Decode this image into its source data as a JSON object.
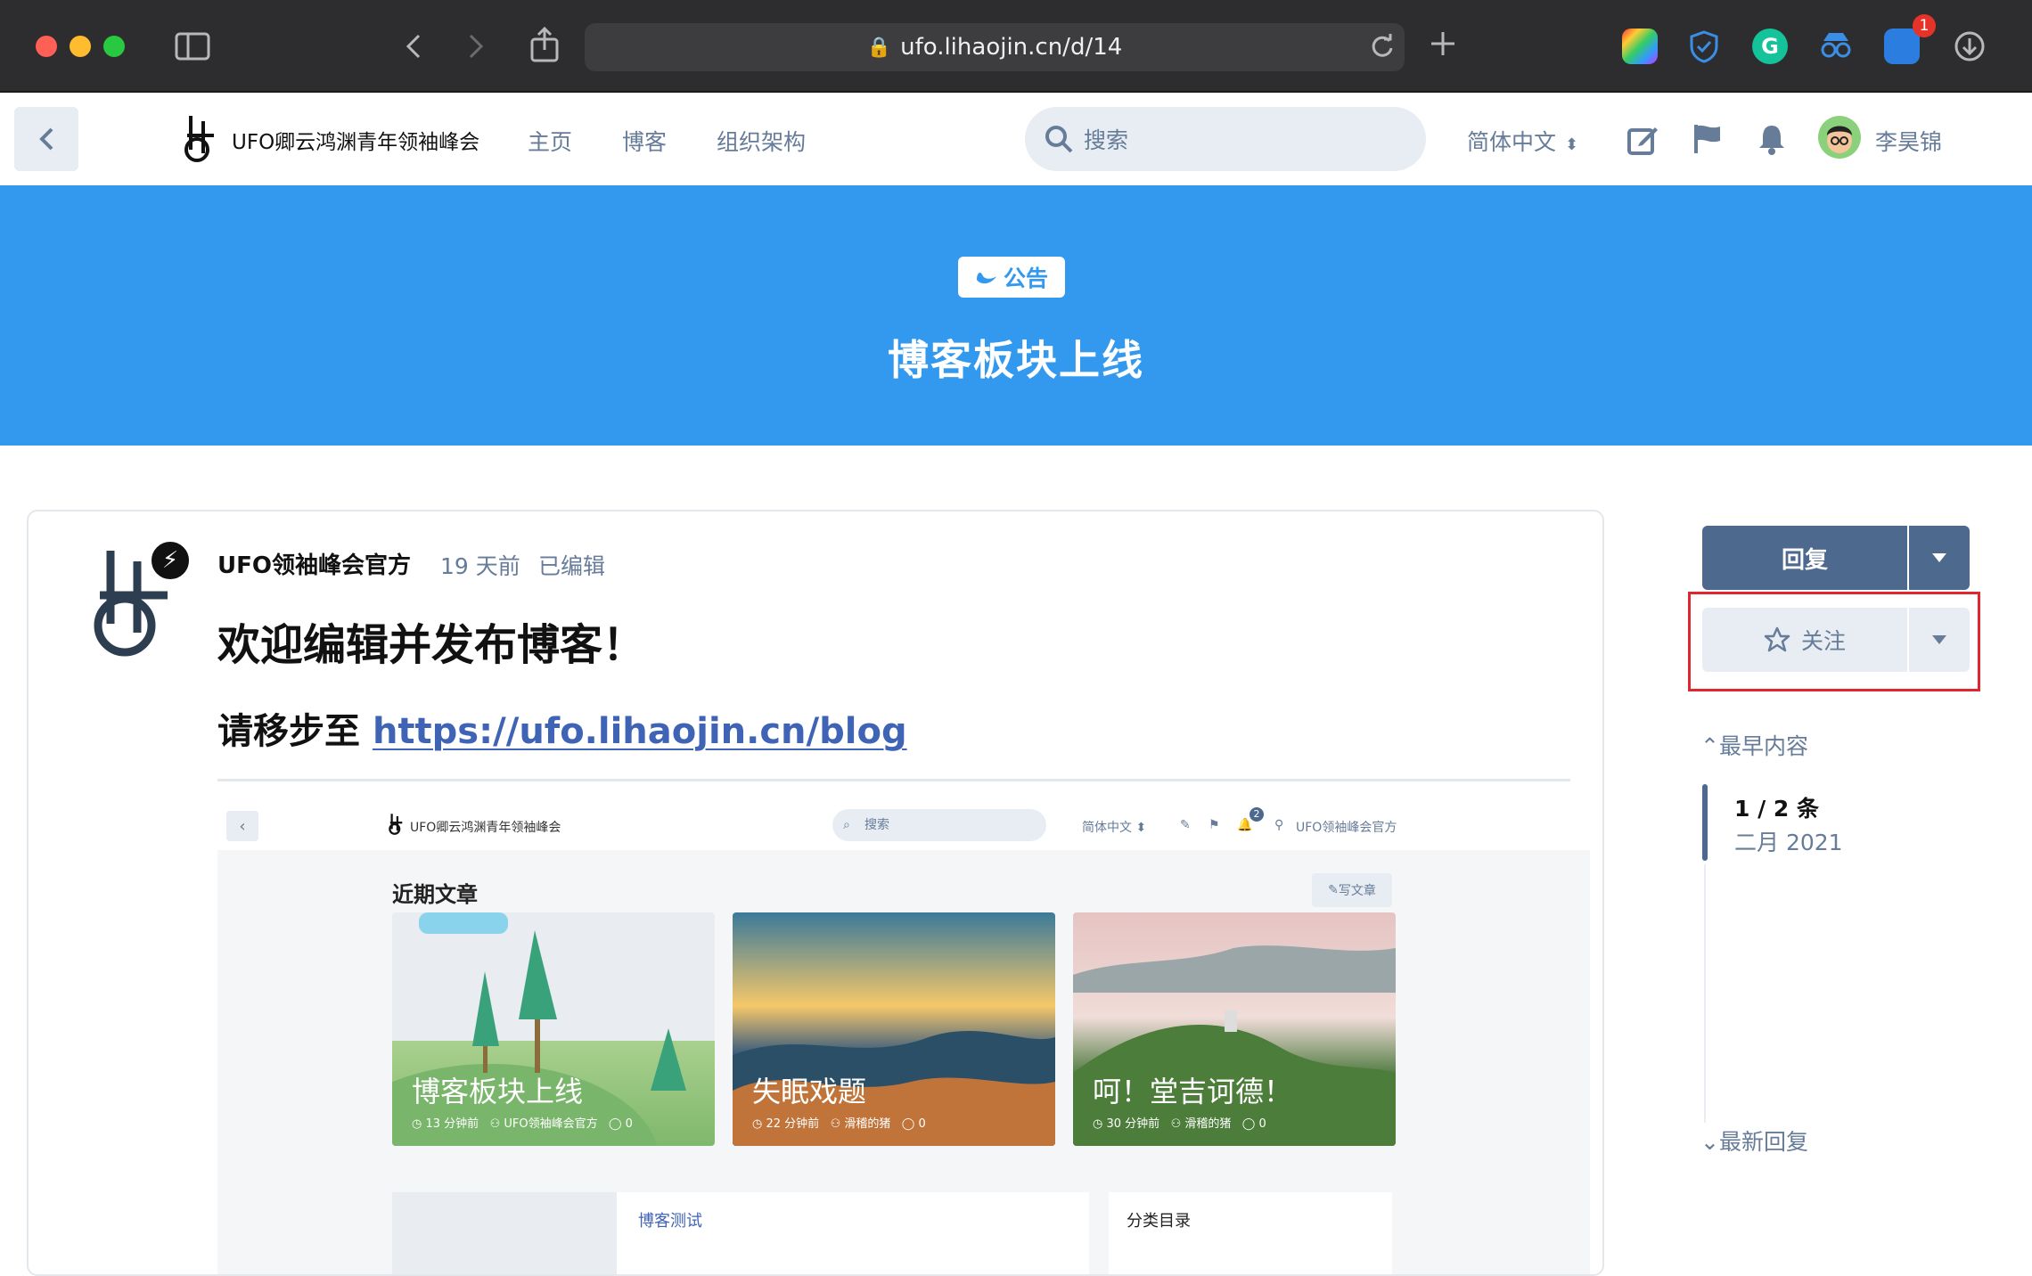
{
  "browser": {
    "url": "ufo.lihaojin.cn/d/14",
    "notification_count": "1"
  },
  "nav": {
    "site_name": "UFO卿云鸿渊青年领袖峰会",
    "links": [
      "主页",
      "博客",
      "组织架构"
    ],
    "search_placeholder": "搜索",
    "language": "简体中文",
    "user_name": "李昊锦"
  },
  "hero": {
    "tag": "公告",
    "title": "博客板块上线",
    "color": "#3399ee"
  },
  "post": {
    "author": "UFO领袖峰会官方",
    "time": "19 天前",
    "edited": "已编辑",
    "title": "欢迎编辑并发布博客！",
    "line_prefix": "请移步至 ",
    "link": "https://ufo.lihaojin.cn/blog"
  },
  "embedded": {
    "site_name": "UFO卿云鸿渊青年领袖峰会",
    "search_placeholder": "搜索",
    "language": "简体中文",
    "notification_count": "2",
    "user_name": "UFO领袖峰会官方",
    "heading": "近期文章",
    "write_button": "写文章",
    "cards": [
      {
        "title": "博客板块上线",
        "time": "13 分钟前",
        "author": "UFO领袖峰会官方",
        "comments": "0"
      },
      {
        "title": "失眠戏题",
        "time": "22 分钟前",
        "author": "滑稽的猪",
        "comments": "0"
      },
      {
        "title": "呵！堂吉诃德！",
        "time": "30 分钟前",
        "author": "滑稽的猪",
        "comments": "0"
      }
    ],
    "lower_left_title": "博客测试",
    "lower_right_title": "分类目录"
  },
  "sidebar": {
    "reply_label": "回复",
    "follow_label": "关注",
    "earliest_label": "最早内容",
    "count": "1 / 2 条",
    "date": "二月 2021",
    "latest_label": "最新回复",
    "accent": "#4d698e",
    "highlight_color": "#e0262e"
  }
}
